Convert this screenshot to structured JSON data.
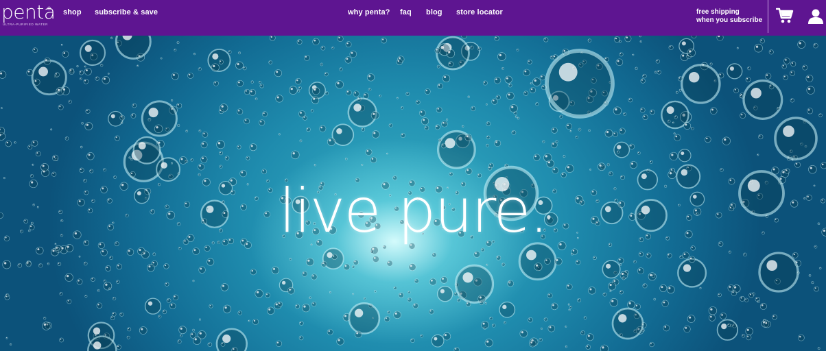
{
  "brand": {
    "name": "penta",
    "reg_mark": "®",
    "tagline": "ULTRA-PURIFIED WATER"
  },
  "nav": {
    "left": [
      {
        "label": "shop"
      },
      {
        "label": "subscribe & save"
      }
    ],
    "center": [
      {
        "label": "why penta?"
      },
      {
        "label": "faq"
      },
      {
        "label": "blog"
      },
      {
        "label": "store locator"
      }
    ],
    "shipping": {
      "line1": "free shipping",
      "line2": "when you subscribe"
    },
    "icons": [
      "cart-icon",
      "user-icon"
    ]
  },
  "hero": {
    "headline": "live pure."
  },
  "colors": {
    "nav_bg": "#5e1591",
    "text": "#ffffff",
    "water_dark": "#0c527a",
    "water_light": "#38b2c7"
  }
}
